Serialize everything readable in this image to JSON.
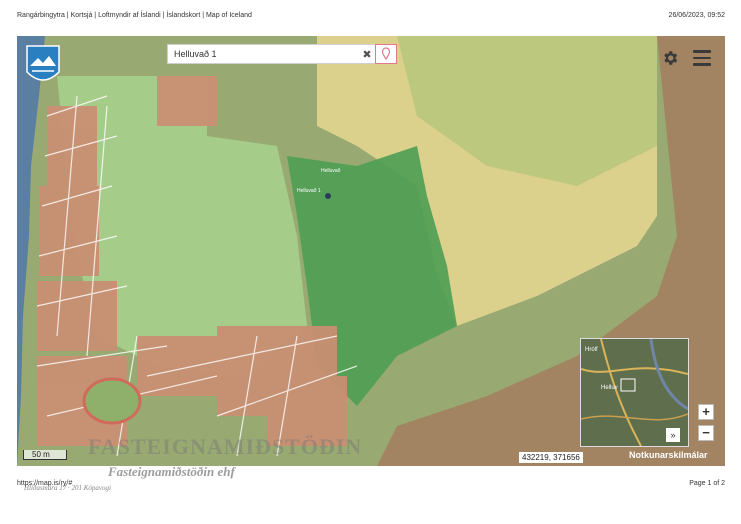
{
  "header": {
    "title": "Rangárbingytra | Kortsjá | Loftmyndir af Íslandi | Íslandskort | Map of Iceland",
    "datetime": "26/06/2023, 09:52"
  },
  "map": {
    "search": {
      "value": "Helluvað 1"
    },
    "scale_label": "50 m",
    "coordinates": "432219, 371656",
    "layer_label": "Notkunarskilmálar",
    "labels": {
      "parcel": "Helluvað",
      "house": "Helluvað 1"
    },
    "minimap": {
      "label_a": "Hrólf",
      "label_b": "Helluv",
      "expand_label": "»"
    },
    "zoom_in_label": "+",
    "zoom_out_label": "−"
  },
  "watermark": {
    "line1": "FASTEIGNAMIÐSTÖÐIN",
    "line2": "Fasteignamiðstöðin ehf",
    "line3": "Hlíðasmára 17 · 201 Kópavogi"
  },
  "footer": {
    "url": "https://map.is/ry/#",
    "page": "Page 1 of 2"
  },
  "colors": {
    "green_zone": "#7bbf6a",
    "dark_green_zone": "#4c9a52",
    "yellow_zone": "#e9d78a",
    "brown_zone": "#a07b5e",
    "river": "#5a7fa0"
  },
  "icons": [
    "logo-icon",
    "clear-icon",
    "location-pin-icon",
    "gear-icon",
    "menu-icon"
  ]
}
